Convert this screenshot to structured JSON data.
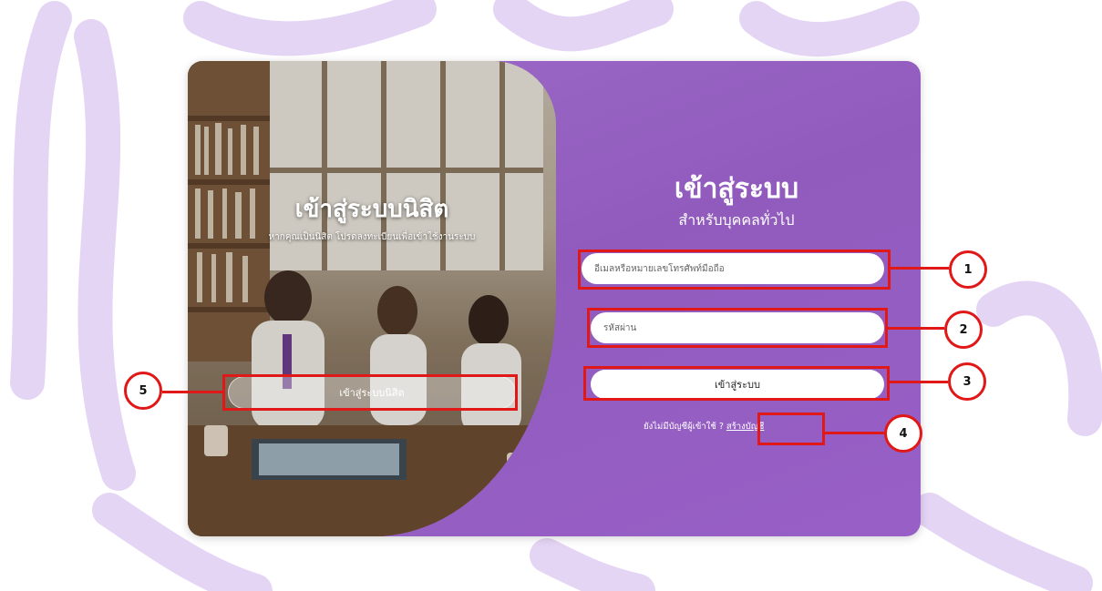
{
  "colors": {
    "panel_purple": "#9660c4",
    "annotation_red": "#e01818",
    "background_swoosh": "#dcc7f2"
  },
  "student_panel": {
    "title": "เข้าสู่ระบบนิสิต",
    "subtitle": "หากคุณเป็นนิสิต โปรดลงทะเบียนเพื่อเข้าใช้งานระบบ",
    "button_label": "เข้าสู่ระบบนิสิต"
  },
  "login_panel": {
    "title": "เข้าสู่ระบบ",
    "subtitle": "สำหรับบุคคลทั่วไป",
    "email_placeholder": "อีเมลหรือหมายเลขโทรศัพท์มือถือ",
    "password_placeholder": "รหัสผ่าน",
    "submit_label": "เข้าสู่ระบบ",
    "no_account_text": "ยังไม่มีบัญชีผู้เข้าใช้ ?",
    "create_account_link": "สร้างบัญชี"
  },
  "annotations": [
    {
      "label": "1",
      "target": "email field"
    },
    {
      "label": "2",
      "target": "password field"
    },
    {
      "label": "3",
      "target": "login button"
    },
    {
      "label": "4",
      "target": "create account link"
    },
    {
      "label": "5",
      "target": "student login button"
    }
  ]
}
